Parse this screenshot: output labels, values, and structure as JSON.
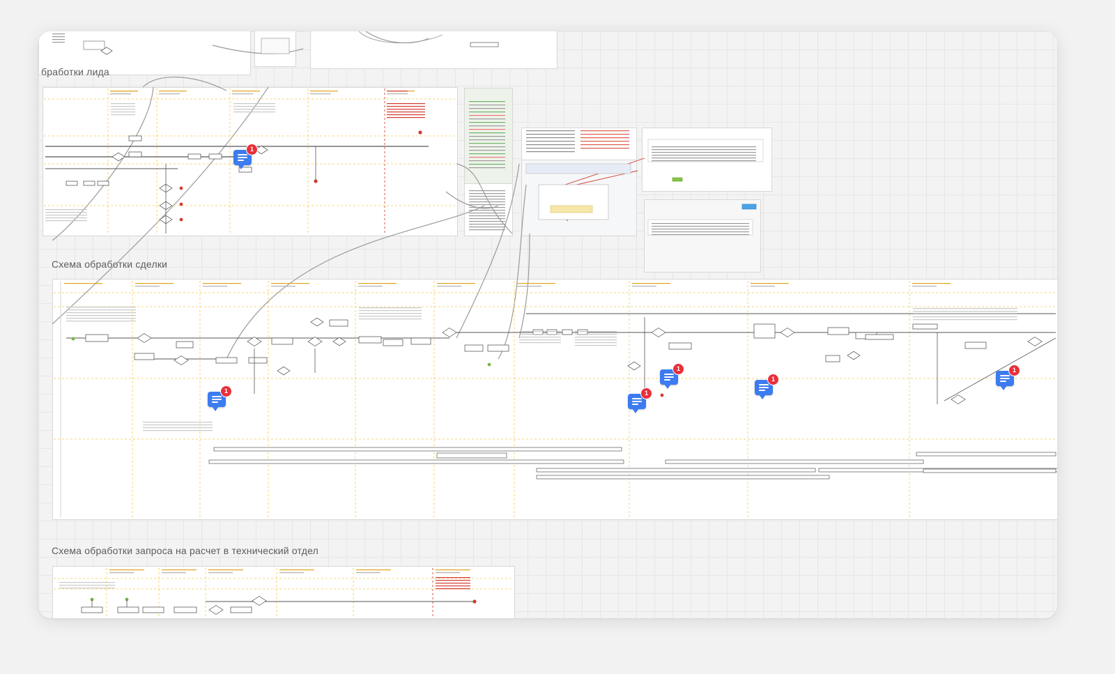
{
  "sections": {
    "lead_title": "бработки лида",
    "deal_title": "Схема обработки сделки",
    "tech_title": "Схема обработки запроса на расчет в технический отдел"
  },
  "comments": [
    {
      "count": "1"
    },
    {
      "count": "1"
    },
    {
      "count": "1"
    },
    {
      "count": "1"
    },
    {
      "count": "1"
    },
    {
      "count": "1"
    }
  ],
  "colors": {
    "canvas": "#f3f3f3",
    "lane_divider": "#f5c84a",
    "connector": "#9a9a9a",
    "comment_icon": "#3c7bf0",
    "badge": "#e8303a",
    "end_event": "#d23b2f",
    "start_event": "#7ab648"
  },
  "icons": [
    "comment-icon",
    "notification-badge"
  ]
}
